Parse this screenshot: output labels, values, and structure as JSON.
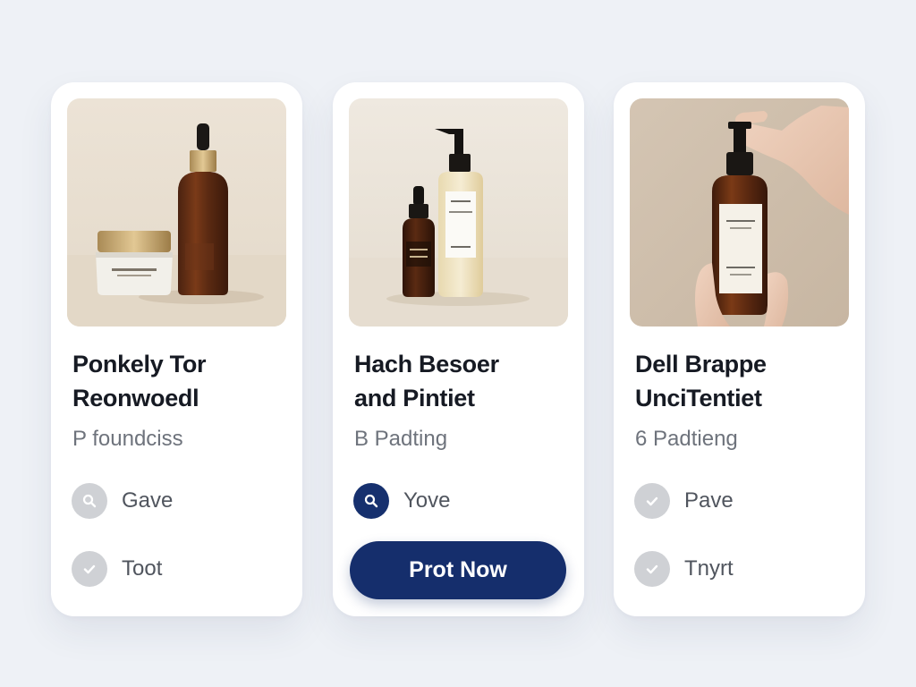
{
  "cards": [
    {
      "title_line1": "Ponkely Tor",
      "title_line2": "Reonwoedl",
      "subtitle": "P foundciss",
      "options": [
        {
          "label": "Gave",
          "icon": "search-icon",
          "active": false
        },
        {
          "label": "Toot",
          "icon": "check-icon",
          "active": false
        }
      ]
    },
    {
      "title_line1": "Hach Besoer",
      "title_line2": "and Pintiet",
      "subtitle": "B Padting",
      "options": [
        {
          "label": "Yove",
          "icon": "search-icon",
          "active": true
        }
      ],
      "cta_label": "Prot Now"
    },
    {
      "title_line1": "Dell Brappe",
      "title_line2": "UnciTentiet",
      "subtitle": "6 Padtieng",
      "options": [
        {
          "label": "Pave",
          "icon": "check-icon",
          "active": false
        },
        {
          "label": "Tnyrt",
          "icon": "check-icon",
          "active": false
        }
      ]
    }
  ],
  "colors": {
    "background": "#eef1f6",
    "card": "#ffffff",
    "accent": "#152e6c",
    "inactive_circle": "#cfd1d5",
    "title": "#161a23",
    "subtitle": "#6e737c"
  }
}
